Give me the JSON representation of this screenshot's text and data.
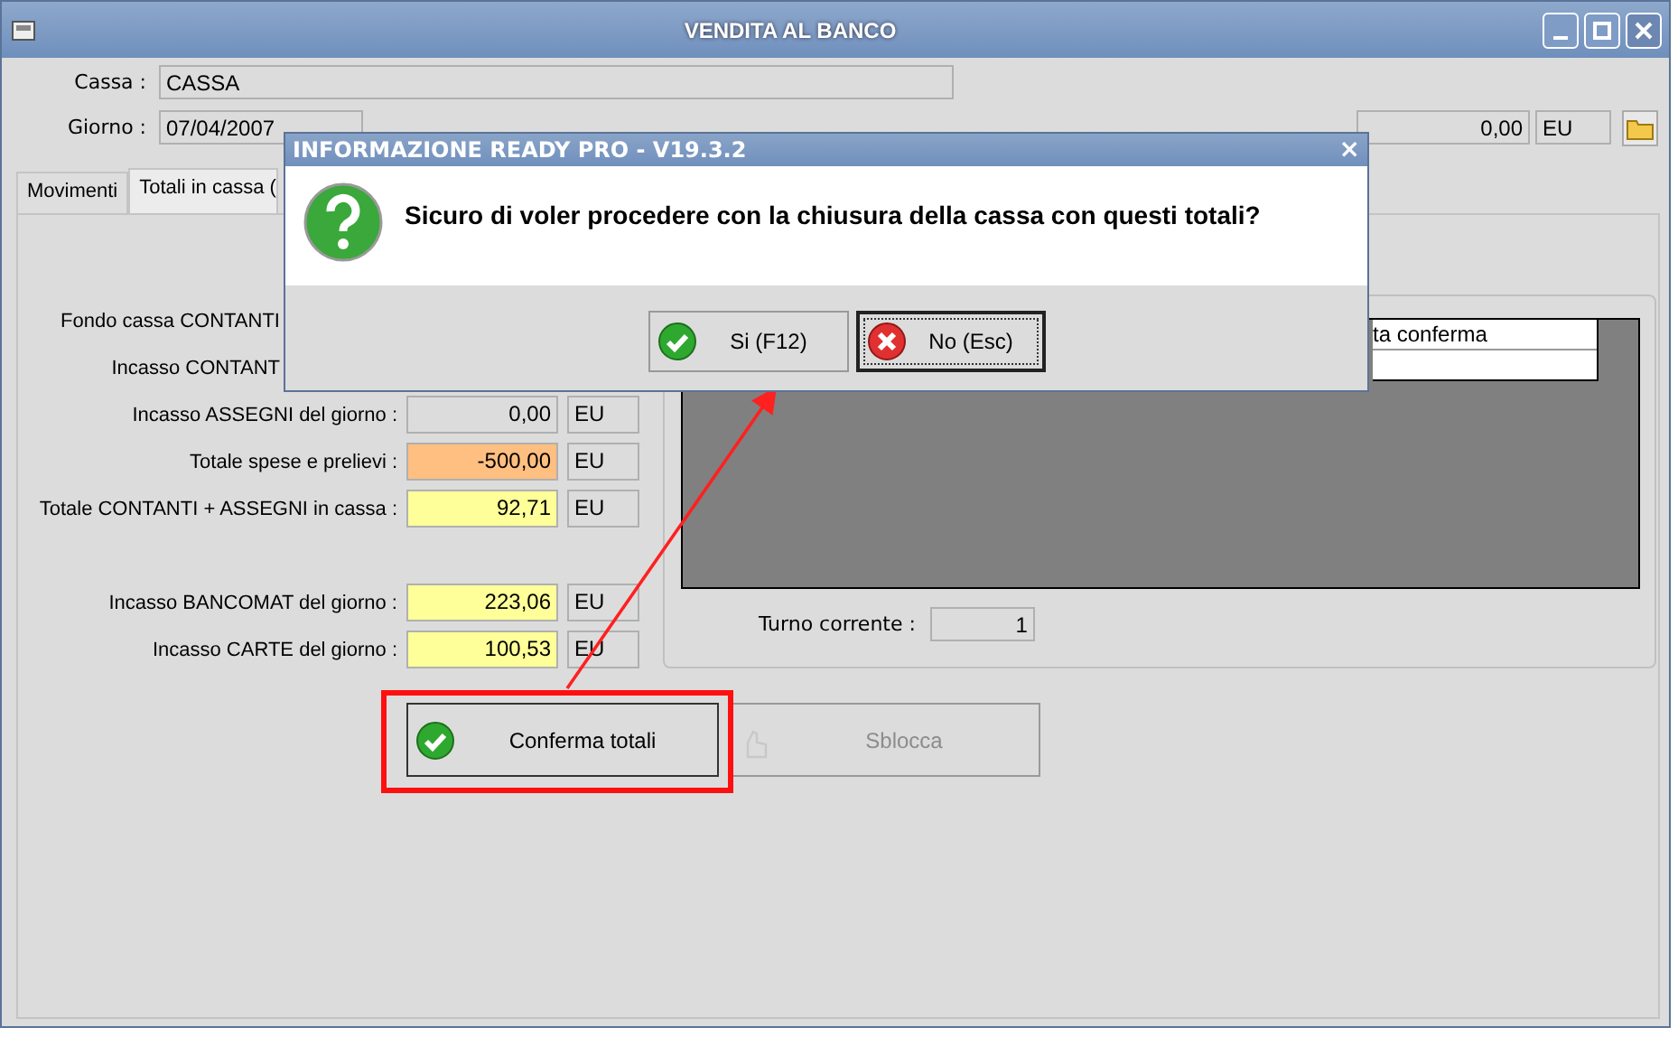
{
  "window": {
    "title": "VENDITA AL BANCO"
  },
  "header": {
    "cassa_label": "Cassa :",
    "cassa_value": "CASSA",
    "giorno_label": "Giorno :",
    "giorno_value": "07/04/2007",
    "total_value": "0,00",
    "total_unit": "EU"
  },
  "tabs": [
    {
      "label": "Movimenti",
      "selected": false
    },
    {
      "label": "Totali in cassa (",
      "selected": true
    }
  ],
  "totals": [
    {
      "label": "Fondo cassa CONTANTI"
    },
    {
      "label": "Incasso CONTANT"
    },
    {
      "label": "Incasso ASSEGNI del giorno :",
      "value": "0,00",
      "unit": "EU",
      "color": "#dcdcdc"
    },
    {
      "label": "Totale spese e prelievi :",
      "value": "-500,00",
      "unit": "EU",
      "color": "#ffbf80"
    },
    {
      "label": "Totale CONTANTI + ASSEGNI in cassa :",
      "value": "92,71",
      "unit": "EU",
      "color": "#ffff99"
    },
    {
      "label": "Incasso BANCOMAT del giorno :",
      "value": "223,06",
      "unit": "EU",
      "color": "#ffff99",
      "gap_before": true
    },
    {
      "label": "Incasso CARTE del giorno :",
      "value": "100,53",
      "unit": "EU",
      "color": "#ffff99"
    }
  ],
  "grid": {
    "column": "ta conferma"
  },
  "turno": {
    "label": "Turno corrente :",
    "value": "1"
  },
  "buttons": [
    {
      "label": "Conferma totali",
      "disabled": false
    },
    {
      "label": "Sblocca",
      "disabled": true
    }
  ],
  "dialog": {
    "title": "INFORMAZIONE READY PRO - V19.3.2",
    "close": "×",
    "message": "Sicuro di voler procedere con la chiusura della cassa con questi totali?",
    "buttons": [
      {
        "label": "Si (F12)",
        "kind": "yes",
        "focused": false
      },
      {
        "label": "No (Esc)",
        "kind": "no",
        "focused": true
      }
    ]
  }
}
